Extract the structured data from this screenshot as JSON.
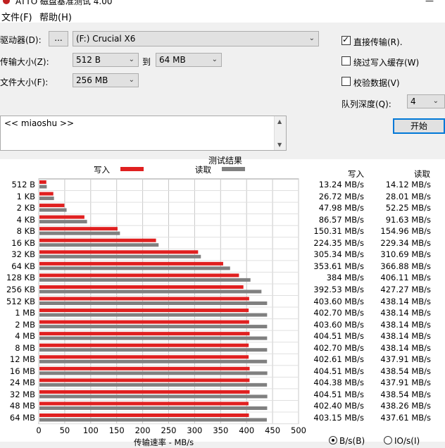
{
  "window": {
    "title": "ATTO 磁盘基准测试 4.00"
  },
  "menu": {
    "file": "文件(F)",
    "help": "帮助(H)"
  },
  "controls": {
    "drive_label": "驱动器(D):",
    "browse_label": "...",
    "drive_value": "(F:) Crucial X6",
    "transfer_label": "传输大小(Z):",
    "transfer_from": "512 B",
    "to_label": "到",
    "transfer_to": "64 MB",
    "filesize_label": "文件大小(F):",
    "filesize_value": "256 MB",
    "direct_io_label": "直接传输(R).",
    "direct_io_checked": true,
    "bypass_cache_label": "绕过写入缓存(W)",
    "bypass_cache_checked": false,
    "verify_label": "校验数据(V)",
    "verify_checked": false,
    "queue_label": "队列深度(Q):",
    "queue_value": "4",
    "start_label": "开始"
  },
  "description": {
    "text": "<< miaoshu >>"
  },
  "chart_data": {
    "type": "bar",
    "title": "测试结果",
    "legend": [
      {
        "name": "写入",
        "color": "#e02020"
      },
      {
        "name": "读取",
        "color": "#808080"
      }
    ],
    "xlabel": "传输速率 - MB/s",
    "xlim": [
      0,
      500
    ],
    "xticks": [
      0,
      50,
      100,
      150,
      200,
      250,
      300,
      350,
      400,
      450,
      500
    ],
    "categories": [
      "512 B",
      "1 KB",
      "2 KB",
      "4 KB",
      "8 KB",
      "16 KB",
      "32 KB",
      "64 KB",
      "128 KB",
      "256 KB",
      "512 KB",
      "1 MB",
      "2 MB",
      "4 MB",
      "8 MB",
      "12 MB",
      "16 MB",
      "24 MB",
      "32 MB",
      "48 MB",
      "64 MB"
    ],
    "series": [
      {
        "name": "写入",
        "color": "#e02020",
        "values": [
          13.24,
          26.72,
          47.98,
          86.57,
          150.31,
          224.35,
          305.34,
          353.61,
          384,
          392.53,
          403.6,
          402.7,
          403.6,
          404.51,
          402.7,
          402.61,
          404.51,
          404.38,
          404.51,
          402.4,
          403.15
        ]
      },
      {
        "name": "读取",
        "color": "#808080",
        "values": [
          14.12,
          28.01,
          52.25,
          91.63,
          154.96,
          229.34,
          310.69,
          366.88,
          406.11,
          427.27,
          438.14,
          438.14,
          438.14,
          438.14,
          438.14,
          437.91,
          438.54,
          437.91,
          438.54,
          438.26,
          437.61
        ]
      }
    ],
    "write_header": "写入",
    "read_header": "读取",
    "write_text": [
      "13.24 MB/s",
      "26.72 MB/s",
      "47.98 MB/s",
      "86.57 MB/s",
      "150.31 MB/s",
      "224.35 MB/s",
      "305.34 MB/s",
      "353.61 MB/s",
      "384 MB/s",
      "392.53 MB/s",
      "403.60 MB/s",
      "402.70 MB/s",
      "403.60 MB/s",
      "404.51 MB/s",
      "402.70 MB/s",
      "402.61 MB/s",
      "404.51 MB/s",
      "404.38 MB/s",
      "404.51 MB/s",
      "402.40 MB/s",
      "403.15 MB/s"
    ],
    "read_text": [
      "14.12 MB/s",
      "28.01 MB/s",
      "52.25 MB/s",
      "91.63 MB/s",
      "154.96 MB/s",
      "229.34 MB/s",
      "310.69 MB/s",
      "366.88 MB/s",
      "406.11 MB/s",
      "427.27 MB/s",
      "438.14 MB/s",
      "438.14 MB/s",
      "438.14 MB/s",
      "438.14 MB/s",
      "438.14 MB/s",
      "437.91 MB/s",
      "438.54 MB/s",
      "437.91 MB/s",
      "438.54 MB/s",
      "438.26 MB/s",
      "437.61 MB/s"
    ]
  },
  "units": {
    "bytes_label": "B/s(B)",
    "io_label": "IO/s(I)",
    "bytes_selected": true
  }
}
